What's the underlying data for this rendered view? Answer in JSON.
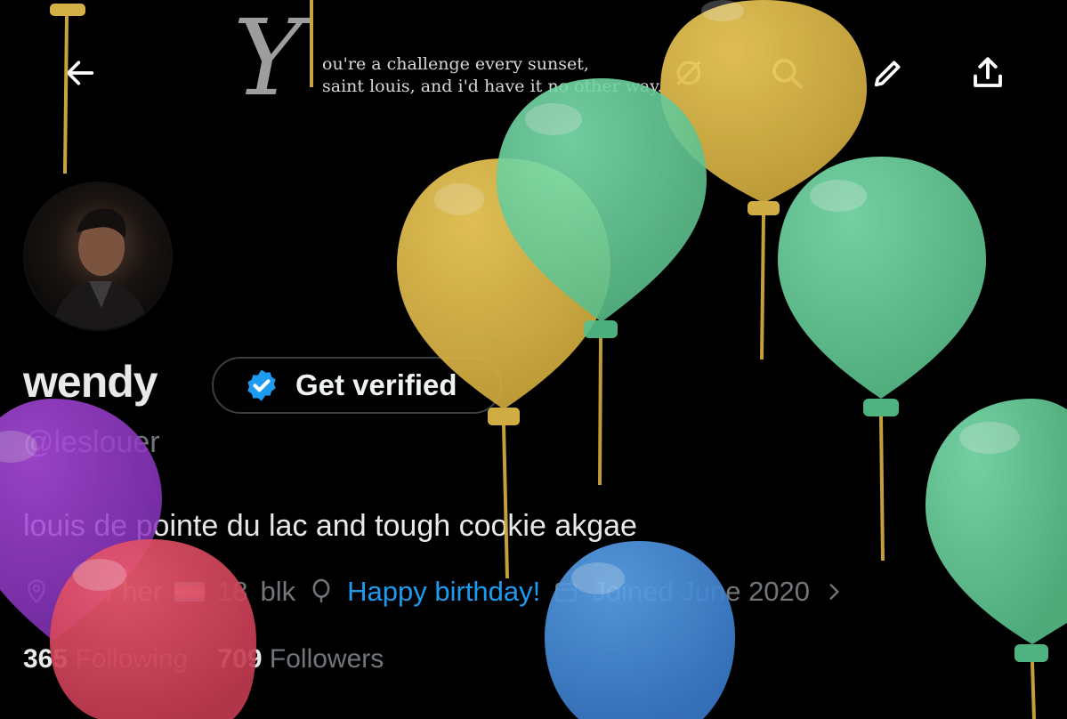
{
  "banner": {
    "script_letter": "Y",
    "quote": "ou're a challenge every sunset,\nsaint louis, and i'd have it no other way."
  },
  "toolbar": {
    "back_icon": "arrow-left-icon",
    "grok_icon": "grok-icon",
    "search_icon": "search-icon",
    "edit_icon": "pencil-icon",
    "share_icon": "share-icon"
  },
  "profile": {
    "name": "wendy",
    "verify_label": "Get verified",
    "handle": "@leslouer",
    "bio": "louis de pointe du lac and tough cookie akgae",
    "pronouns": "she/ her",
    "age": "18",
    "tag": "blk",
    "birthday": "Happy birthday!",
    "joined": "Joined June 2020",
    "following_count": "365",
    "following_label": "Following",
    "followers_count": "709",
    "followers_label": "Followers"
  },
  "colors": {
    "background": "#000000",
    "accent": "#1d9bf0",
    "verified": "#1d9bf0",
    "balloon_yellow": "#e0bb4a",
    "balloon_green": "#6fd3a0",
    "balloon_purple": "#9c3fd0",
    "balloon_red": "#d8455c",
    "balloon_blue": "#4a8fdb"
  }
}
